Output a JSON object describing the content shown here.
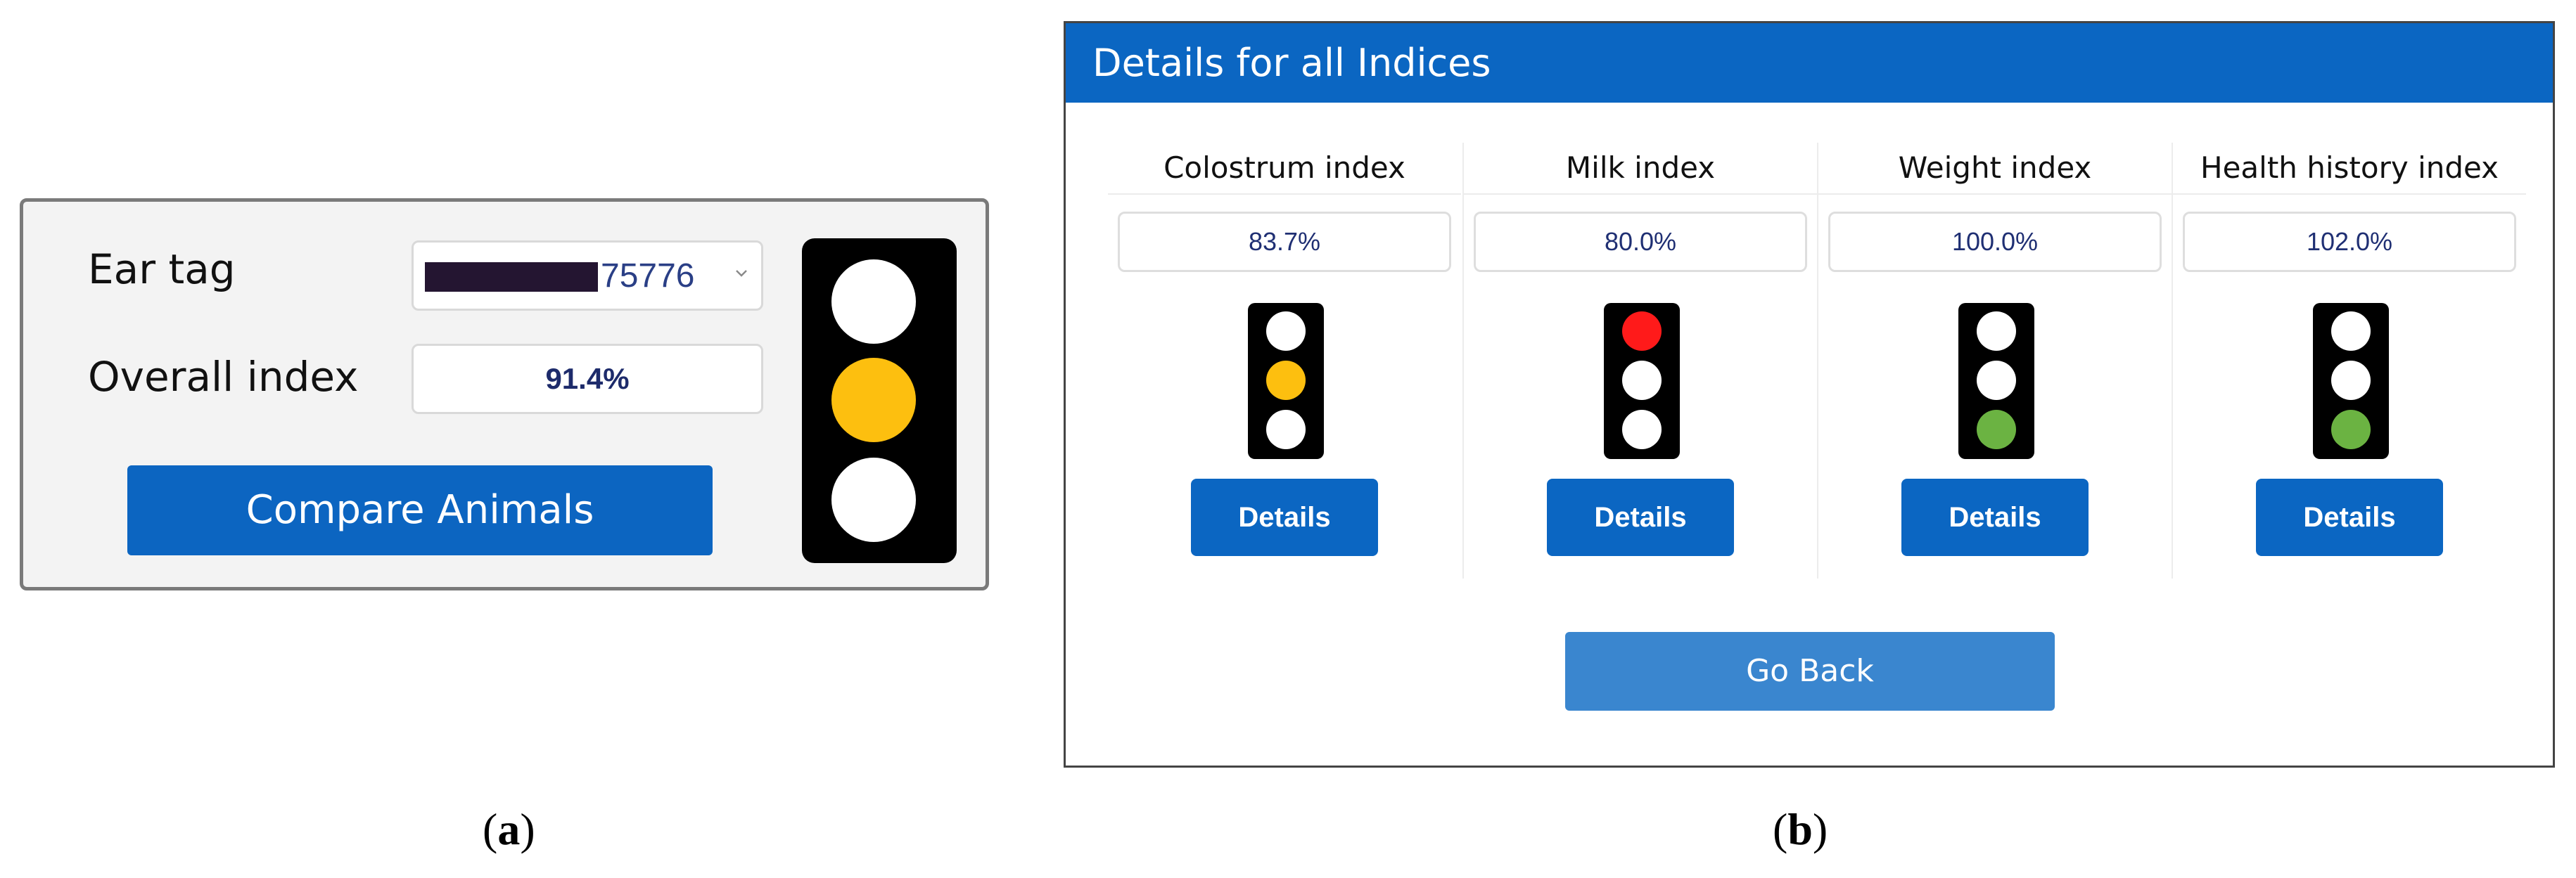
{
  "panel_a": {
    "ear_tag_label": "Ear tag",
    "ear_tag_value": "75776",
    "overall_label": "Overall index",
    "overall_value": "91.4%",
    "compare_button": "Compare Animals",
    "traffic_light": {
      "top": "#ffffff",
      "middle": "#fdbf0f",
      "bottom": "#ffffff"
    },
    "caption_letter": "a"
  },
  "panel_b": {
    "header_title": "Details for all Indices",
    "indices": [
      {
        "name": "Colostrum index",
        "value": "83.7%",
        "details_label": "Details",
        "lights": {
          "top": "#ffffff",
          "middle": "#fdbf0f",
          "bottom": "#ffffff"
        }
      },
      {
        "name": "Milk index",
        "value": "80.0%",
        "details_label": "Details",
        "lights": {
          "top": "#ff1a1a",
          "middle": "#ffffff",
          "bottom": "#ffffff"
        }
      },
      {
        "name": "Weight index",
        "value": "100.0%",
        "details_label": "Details",
        "lights": {
          "top": "#ffffff",
          "middle": "#ffffff",
          "bottom": "#6bb342"
        }
      },
      {
        "name": "Health history index",
        "value": "102.0%",
        "details_label": "Details",
        "lights": {
          "top": "#ffffff",
          "middle": "#ffffff",
          "bottom": "#6bb342"
        }
      }
    ],
    "go_back_button": "Go Back",
    "caption_letter": "b"
  },
  "colors": {
    "primary_blue": "#0b66c2",
    "go_back_blue": "#3a86cf"
  }
}
